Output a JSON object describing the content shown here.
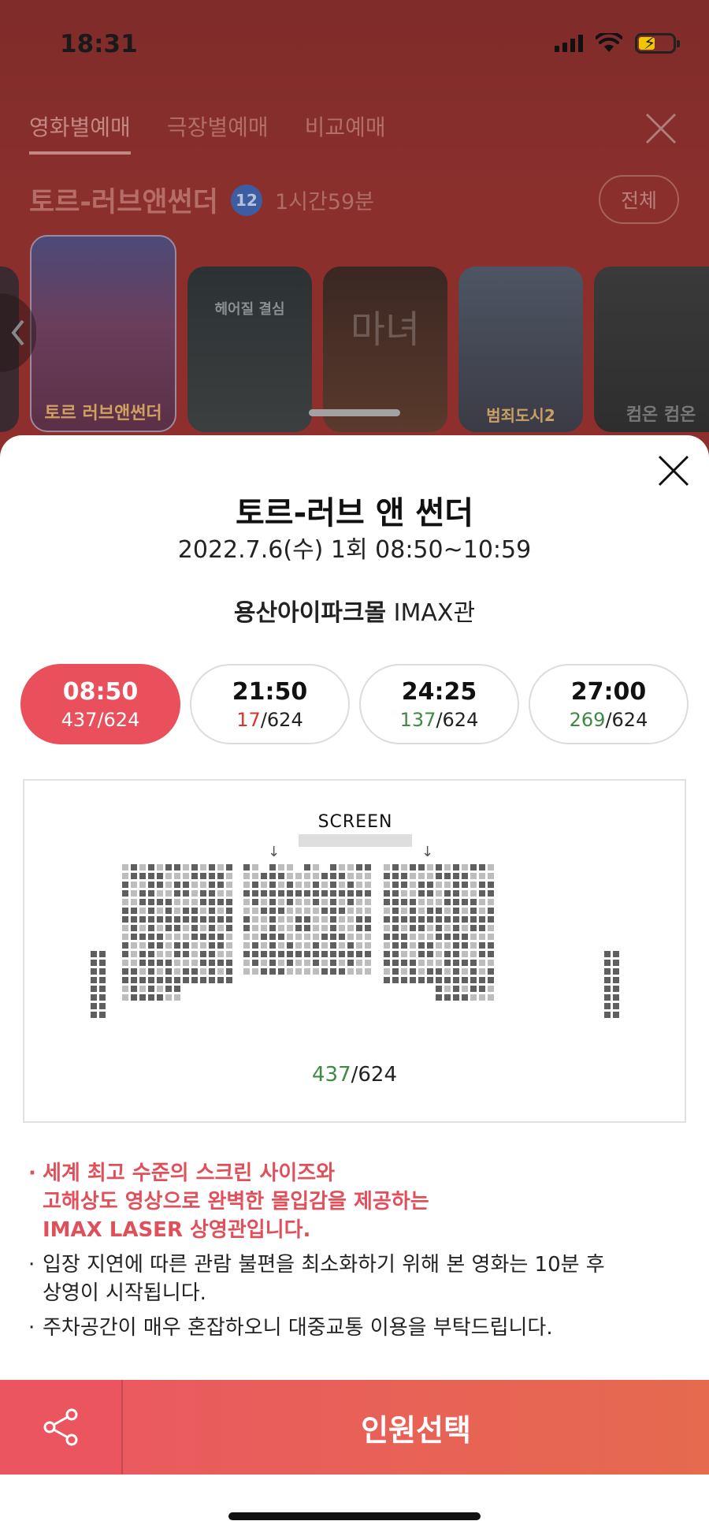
{
  "status_bar": {
    "time": "18:31"
  },
  "background": {
    "tabs": [
      {
        "label": "영화별예매",
        "active": true
      },
      {
        "label": "극장별예매",
        "active": false
      },
      {
        "label": "비교예매",
        "active": false
      }
    ],
    "movie_title": "토르-러브앤썬더",
    "age_rating": "12",
    "runtime": "1시간59분",
    "all_button": "전체",
    "posters": [
      {
        "label": "",
        "color": "#3b2a30"
      },
      {
        "label": "토르 러브앤썬더",
        "color": "#5a4a6a"
      },
      {
        "label": "헤어질 결심",
        "color": "#2f3436"
      },
      {
        "label": "마녀",
        "color": "#3e2a24"
      },
      {
        "label": "범죄도시2",
        "color": "#4a4f5c"
      },
      {
        "label": "컴온 컴온",
        "color": "#3a3a3a"
      }
    ]
  },
  "sheet": {
    "title": "토르-러브 앤 썬더",
    "datetime": "2022.7.6(수) 1회 08:50~10:59",
    "theater_bold": "용산아이파크몰",
    "theater_hall": "IMAX관",
    "showtimes": [
      {
        "time": "08:50",
        "available": "437",
        "total": "/624",
        "active": true,
        "tone": "white"
      },
      {
        "time": "21:50",
        "available": "17",
        "total": "/624",
        "active": false,
        "tone": "red"
      },
      {
        "time": "24:25",
        "available": "137",
        "total": "/624",
        "active": false,
        "tone": "green"
      },
      {
        "time": "27:00",
        "available": "269",
        "total": "/624",
        "active": false,
        "tone": "green"
      }
    ],
    "screen_label": "SCREEN",
    "seat_remaining": "437",
    "seat_total": "/624",
    "notes": [
      {
        "text": "세계 최고 수준의 스크린 사이즈와\n고해상도 영상으로 완벽한 몰입감을 제공하는\nIMAX LASER 상영관입니다.",
        "highlight": true
      },
      {
        "text": "입장 지연에 따른 관람 불편을 최소화하기 위해 본 영화는 10분 후\n상영이 시작됩니다.",
        "highlight": false
      },
      {
        "text": "주차공간이 매우 혼잡하오니 대중교통 이용을 부탁드립니다.",
        "highlight": false
      }
    ],
    "select_button": "인원선택",
    "colors": {
      "accent": "#e9505c",
      "seat_available": "#5f5f5f",
      "seat_taken": "#bdbdbd"
    }
  }
}
